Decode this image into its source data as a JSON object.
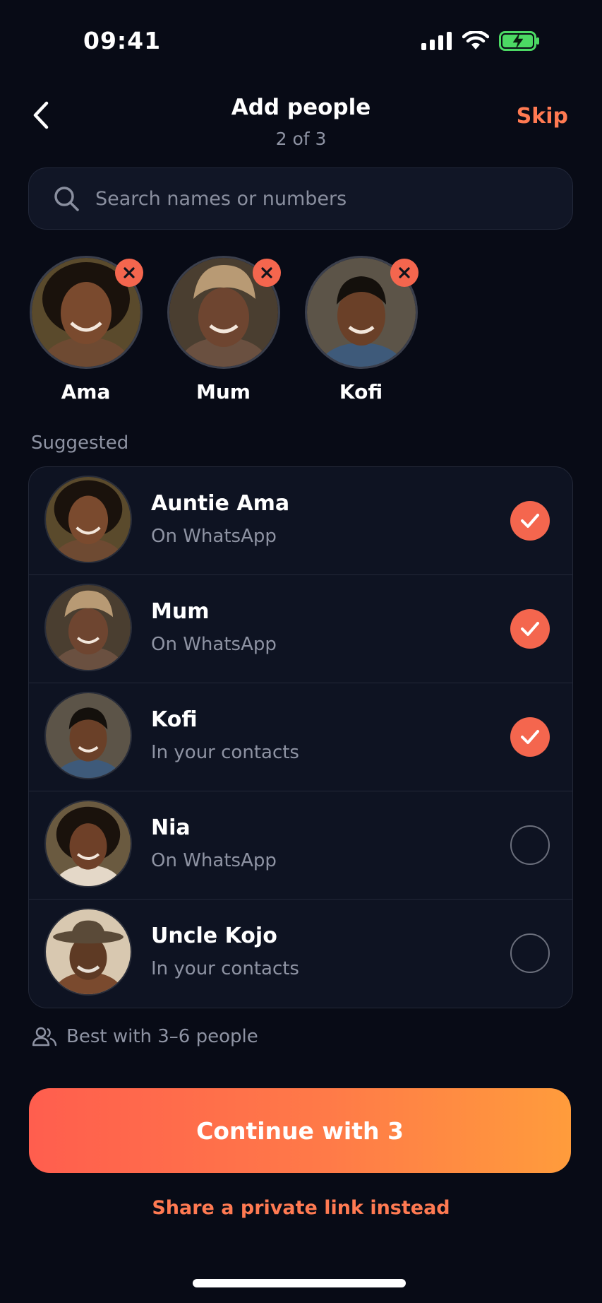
{
  "status_bar": {
    "time": "09:41",
    "icons": [
      "signal-icon",
      "wifi-icon",
      "battery-charging-icon"
    ]
  },
  "nav": {
    "title": "Add people",
    "step": "2 of 3",
    "skip_label": "Skip"
  },
  "search": {
    "placeholder": "Search names or numbers",
    "value": ""
  },
  "selected": [
    {
      "name": "Ama"
    },
    {
      "name": "Mum"
    },
    {
      "name": "Kofi"
    }
  ],
  "suggested_label": "Suggested",
  "suggested": [
    {
      "name": "Auntie Ama",
      "source": "On WhatsApp",
      "selected": true
    },
    {
      "name": "Mum",
      "source": "On WhatsApp",
      "selected": true
    },
    {
      "name": "Kofi",
      "source": "In your contacts",
      "selected": true
    },
    {
      "name": "Nia",
      "source": "On WhatsApp",
      "selected": false
    },
    {
      "name": "Uncle Kojo",
      "source": "In your contacts",
      "selected": false
    }
  ],
  "hint": "Best with 3–6 people",
  "cta_label": "Continue with 3",
  "share_link_label": "Share a private link instead",
  "colors": {
    "accent": "#f4664e",
    "background": "#080b16",
    "battery": "#4cd964"
  }
}
